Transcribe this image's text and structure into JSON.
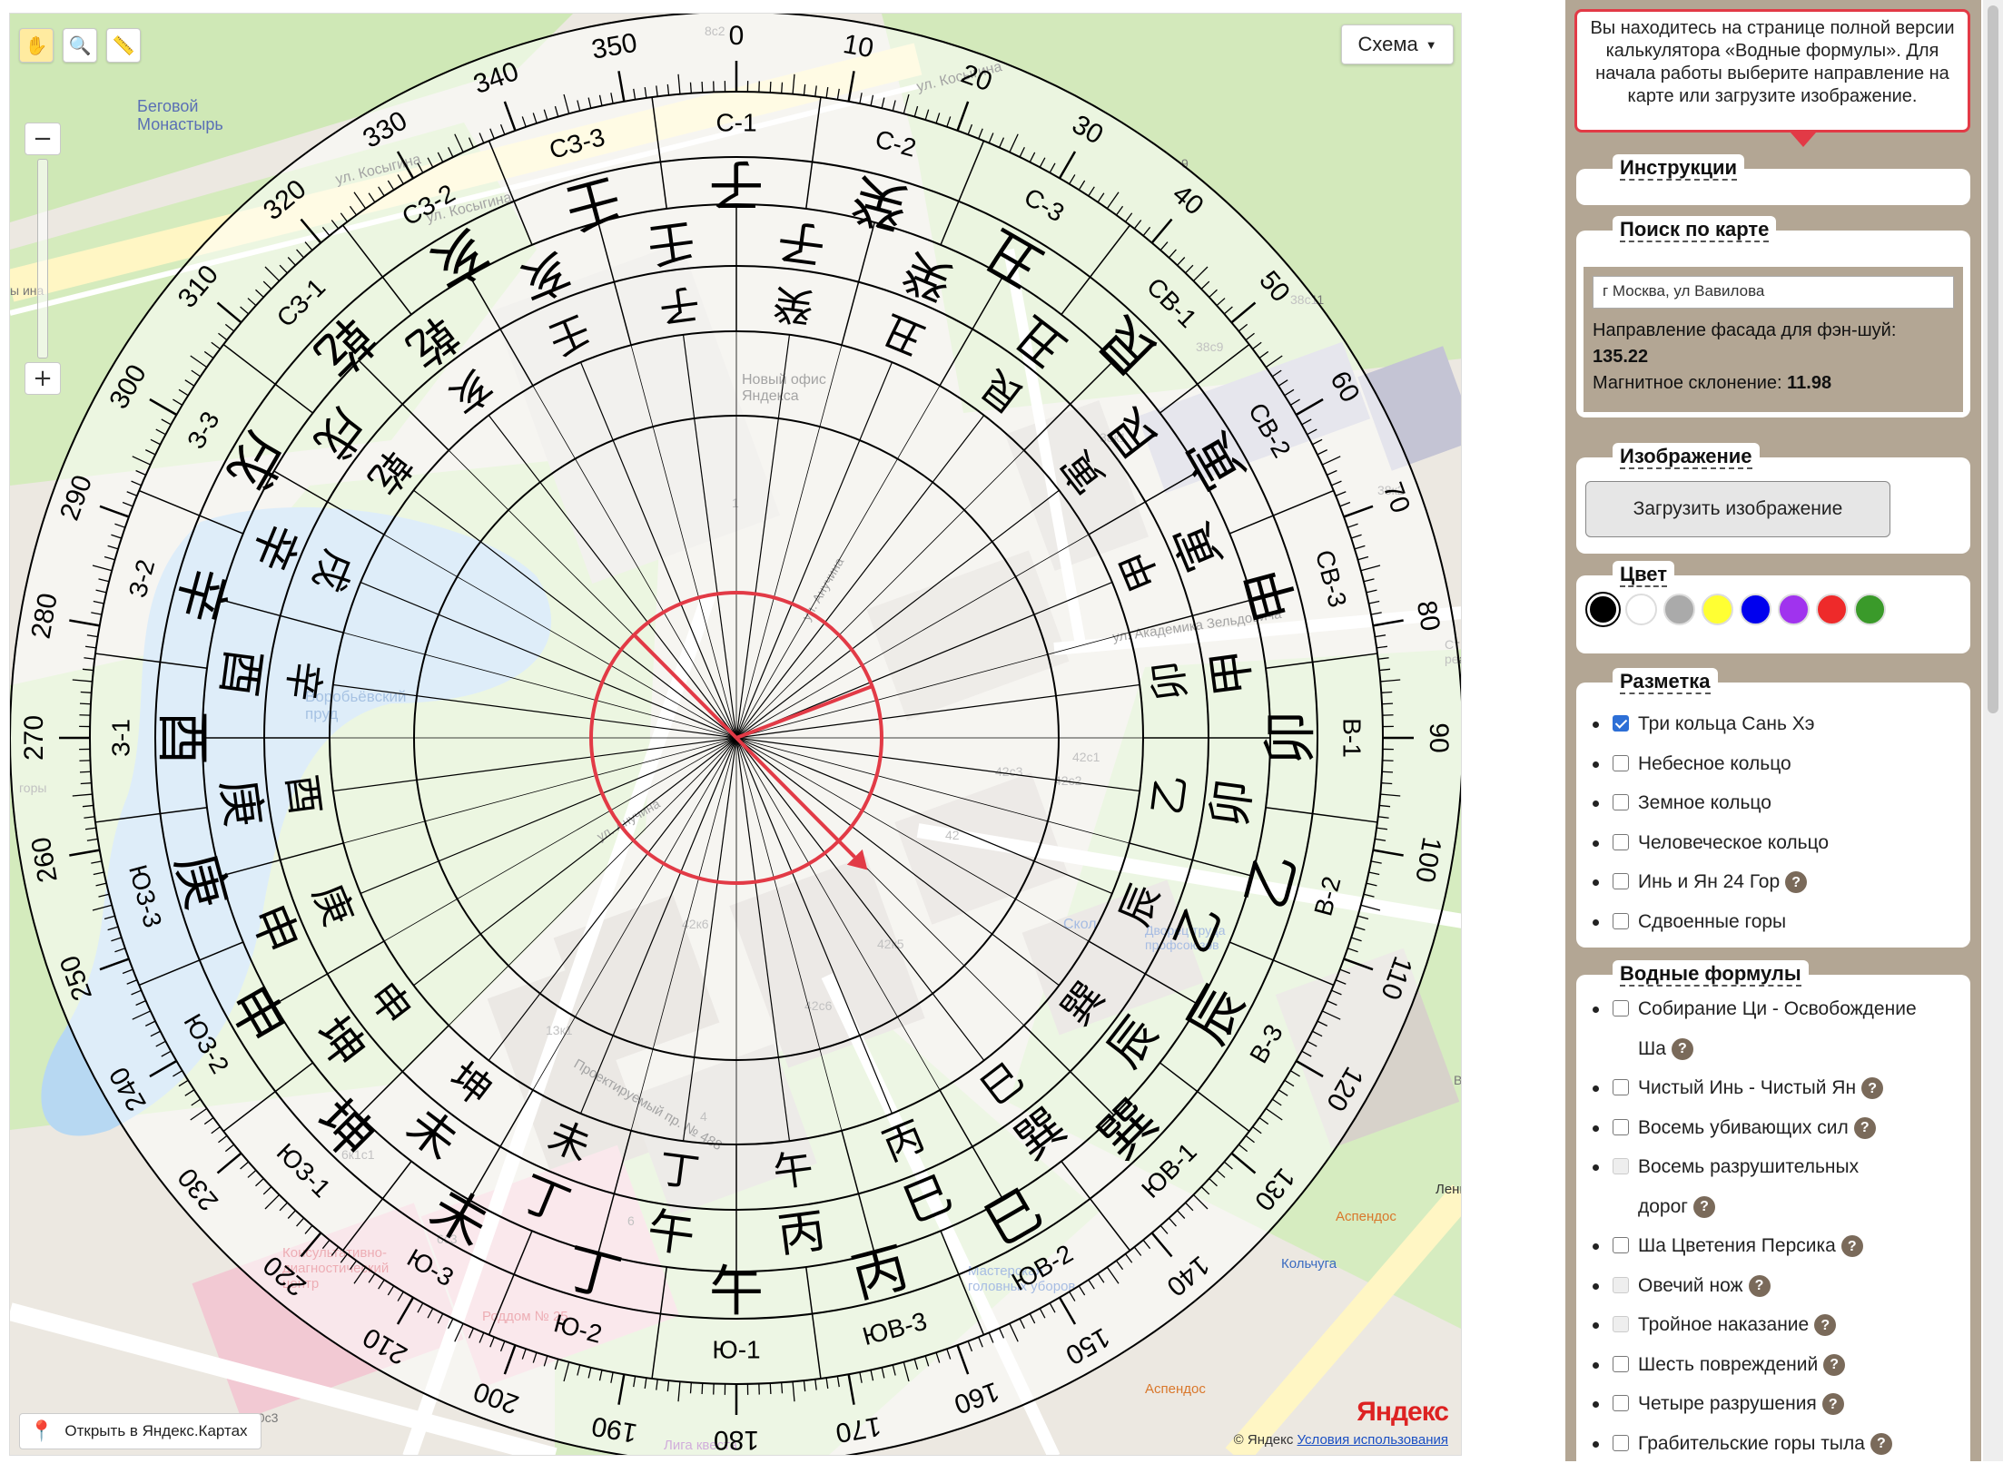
{
  "map": {
    "schema_label": "Схема",
    "open_label": "Открыть в Яндекс.Картах",
    "copyright": "© Яндекс",
    "terms": "Условия использования",
    "logo": "Яндекс",
    "labels": [
      {
        "t": "Беговой\nМонастырь",
        "c": "#5a6fb5"
      },
      {
        "t": "ул. Косыгина",
        "c": "#333"
      },
      {
        "t": "ул. Косыгина",
        "c": "#333"
      },
      {
        "t": "ул. Косыгина",
        "c": "#333"
      },
      {
        "t": "Новый офис\nЯндекса",
        "c": "#333"
      },
      {
        "t": "Воробьёвский\nпруд",
        "c": "#3a78c0"
      },
      {
        "t": "ул. Анучина",
        "c": "#333"
      },
      {
        "t": "ул. Анучина",
        "c": "#333"
      },
      {
        "t": "ул. Академика Зельдовича",
        "c": "#333"
      },
      {
        "t": "Проектируемый пр. № 488",
        "c": "#333"
      },
      {
        "t": "Консультативно-\nдиагностический\nцентр",
        "c": "#d84a5a"
      },
      {
        "t": "Роддом № 25",
        "c": "#d84a5a"
      },
      {
        "t": "Мастерская\nголовных уборов",
        "c": "#3a6bc0"
      },
      {
        "t": "Дворец труда\nпрофсоюзов",
        "c": "#3a6bc0"
      },
      {
        "t": "Аспендос",
        "c": "#d9772b"
      },
      {
        "t": "Аспендос",
        "c": "#d9772b"
      },
      {
        "t": "Кольчуга",
        "c": "#3a6bc0"
      },
      {
        "t": "Лига квеста",
        "c": "#9a4ab0"
      },
      {
        "t": "Ленинский пр.",
        "c": "#333"
      },
      {
        "t": "Скол",
        "c": "#3a6bc0"
      },
      {
        "t": "42к6",
        "c": "#777"
      },
      {
        "t": "42к5",
        "c": "#777"
      },
      {
        "t": "42с6",
        "c": "#777"
      },
      {
        "t": "42",
        "c": "#777"
      },
      {
        "t": "42с3",
        "c": "#777"
      },
      {
        "t": "42с2",
        "c": "#777"
      },
      {
        "t": "42с1",
        "c": "#777"
      },
      {
        "t": "38к2",
        "c": "#777"
      },
      {
        "t": "38с9",
        "c": "#777"
      },
      {
        "t": "38к1",
        "c": "#777"
      },
      {
        "t": "38с11",
        "c": "#777"
      },
      {
        "t": "13к1",
        "c": "#777"
      },
      {
        "t": "6к1с1",
        "c": "#777"
      },
      {
        "t": "6с3",
        "c": "#777"
      },
      {
        "t": "10с3",
        "c": "#777"
      },
      {
        "t": "8с2",
        "c": "#777"
      },
      {
        "t": "9",
        "c": "#777"
      },
      {
        "t": "1",
        "c": "#777"
      },
      {
        "t": "4",
        "c": "#777"
      },
      {
        "t": "6",
        "c": "#777"
      },
      {
        "t": "горы",
        "c": "#777"
      },
      {
        "t": "ы ина",
        "c": "#777"
      },
      {
        "t": "Ви",
        "c": "#777"
      },
      {
        "t": "Ст\nреал",
        "c": "#777"
      }
    ]
  },
  "compass": {
    "facade_angle": 135.22,
    "declination": 11.98,
    "tick_numbers": [
      "0",
      "10",
      "20",
      "30",
      "40",
      "50",
      "60",
      "70",
      "80",
      "90",
      "100",
      "110",
      "120",
      "130",
      "140",
      "150",
      "160",
      "170",
      "180",
      "190",
      "200",
      "210",
      "220",
      "230",
      "240",
      "250",
      "260",
      "270",
      "280",
      "290",
      "300",
      "310",
      "320",
      "330",
      "340",
      "350"
    ],
    "mountains": [
      "С-2",
      "С-3",
      "СВ-1",
      "СВ-2",
      "СВ-3",
      "В-1",
      "В-2",
      "В-3",
      "ЮВ-1",
      "ЮВ-2",
      "ЮВ-3",
      "Ю-1",
      "Ю-2",
      "Ю-3",
      "ЮЗ-1",
      "ЮЗ-2",
      "ЮЗ-3",
      "З-1",
      "З-2",
      "З-3",
      "СЗ-1",
      "СЗ-2",
      "СЗ-3",
      "С-1"
    ],
    "ring_outer": [
      "癸",
      "丑",
      "艮",
      "寅",
      "甲",
      "卯",
      "乙",
      "辰",
      "巽",
      "巳",
      "丙",
      "午",
      "丁",
      "未",
      "坤",
      "申",
      "庚",
      "酉",
      "辛",
      "戌",
      "乾",
      "亥",
      "壬",
      "子"
    ],
    "ring_middle": [
      "癸",
      "丑",
      "艮",
      "寅",
      "甲",
      "卯",
      "乙",
      "辰",
      "巽",
      "巳",
      "丙",
      "午",
      "丁",
      "未",
      "坤",
      "申",
      "庚",
      "酉",
      "辛",
      "戌",
      "乾",
      "亥",
      "壬",
      "子"
    ],
    "ring_inner": [
      "癸",
      "丑",
      "艮",
      "寅",
      "甲",
      "卯",
      "乙",
      "辰",
      "巽",
      "巳",
      "丙",
      "午",
      "丁",
      "未",
      "坤",
      "申",
      "庚",
      "酉",
      "辛",
      "戌",
      "乾",
      "亥",
      "壬",
      "子"
    ]
  },
  "panel": {
    "tip": "Вы находитесь на странице полной версии калькулятора «Водные формулы». Для начала работы выберите направление на карте или загрузите изображение.",
    "instructions": "Инструкции",
    "search": {
      "legend": "Поиск по карте",
      "address": "г Москва, ул Вавилова",
      "facade_label": "Направление фасада для фэн-шуй:",
      "facade_value": "135.22",
      "decl_label": "Магнитное склонение:",
      "decl_value": "11.98"
    },
    "image": {
      "legend": "Изображение",
      "button": "Загрузить изображение"
    },
    "color": {
      "legend": "Цвет",
      "swatches": [
        "#000000",
        "#ffffff",
        "#aaaaaa",
        "#ffff33",
        "#0000ee",
        "#a033ee",
        "#ee2a2a",
        "#3a9a2a"
      ]
    },
    "markup": {
      "legend": "Разметка",
      "items": [
        {
          "label": "Три кольца Сань Хэ",
          "checked": true
        },
        {
          "label": "Небесное кольцо",
          "checked": false
        },
        {
          "label": "Земное кольцо",
          "checked": false
        },
        {
          "label": "Человеческое кольцо",
          "checked": false
        },
        {
          "label": "Инь и Ян 24 Гор",
          "checked": false,
          "help": "?"
        },
        {
          "label": "Сдвоенные горы",
          "checked": false
        }
      ]
    },
    "water": {
      "legend": "Водные формулы",
      "items": [
        {
          "label": "Собирание Ци - Освобождение",
          "label2": "Ша",
          "help": "?"
        },
        {
          "label": "Чистый Инь - Чистый Ян",
          "help": "?"
        },
        {
          "label": "Восемь убивающих сил",
          "help": "?"
        },
        {
          "label": "Восемь разрушительных",
          "label2": "дорог",
          "help": "?",
          "disabled": true
        },
        {
          "label": "Ша Цветения Персика",
          "help": "?"
        },
        {
          "label": "Овечий нож",
          "help": "?",
          "disabled": true
        },
        {
          "label": "Тройное наказание",
          "help": "?",
          "disabled": true
        },
        {
          "label": "Шесть повреждений",
          "help": "?"
        },
        {
          "label": "Четыре разрушения",
          "help": "?"
        },
        {
          "label": "Грабительские горы тыла",
          "help": "?"
        }
      ]
    }
  }
}
